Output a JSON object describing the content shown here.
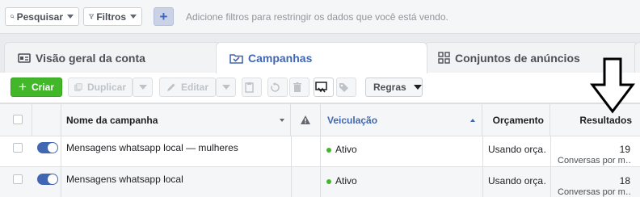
{
  "filterbar": {
    "search_label": "Pesquisar",
    "filters_label": "Filtros",
    "add_filter_symbol": "+",
    "hint": "Adicione filtros para restringir os dados que você está vendo."
  },
  "tabs": [
    {
      "label": "Visão geral da conta",
      "icon": "account-overview-icon"
    },
    {
      "label": "Campanhas",
      "icon": "folder-icon",
      "active": true
    },
    {
      "label": "Conjuntos de anúncios",
      "icon": "grid-icon"
    }
  ],
  "toolbar": {
    "create_label": "Criar",
    "duplicate_label": "Duplicar",
    "edit_label": "Editar",
    "rules_label": "Regras"
  },
  "table": {
    "columns": {
      "name": "Nome da campanha",
      "delivery": "Veiculação",
      "budget": "Orçamento",
      "results": "Resultados"
    },
    "rows": [
      {
        "name": "Mensagens whatsapp local — mulheres",
        "delivery": "Ativo",
        "budget": "Usando orça…",
        "result_value": "19",
        "result_type": "Conversas por m…"
      },
      {
        "name": "Mensagens whatsapp local",
        "delivery": "Ativo",
        "budget": "Usando orça…",
        "result_value": "18",
        "result_type": "Conversas por m…"
      }
    ]
  },
  "colors": {
    "accent": "#4267b2",
    "create_green": "#42b72a",
    "link": "#365899",
    "active_dot": "#42b72a"
  }
}
